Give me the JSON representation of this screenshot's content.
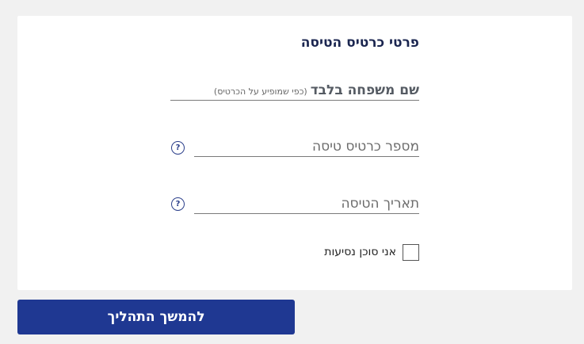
{
  "form": {
    "title": "פרטי כרטיס הטיסה",
    "last_name_label": "שם משפחה בלבד",
    "last_name_hint": "(כפי שמופיע על הכרטיס)",
    "ticket_number_placeholder": "מספר כרטיס טיסה",
    "flight_date_placeholder": "תאריך הטיסה",
    "help_glyph": "?",
    "agent_checkbox_label": "אני סוכן נסיעות",
    "agent_checked": false
  },
  "actions": {
    "continue_label": "להמשך התהליך"
  },
  "colors": {
    "page_bg": "#f1f1f1",
    "card_bg": "#ffffff",
    "primary_button": "#1f3892",
    "title_text": "#1b2650",
    "help_icon": "#2a3e8a"
  }
}
